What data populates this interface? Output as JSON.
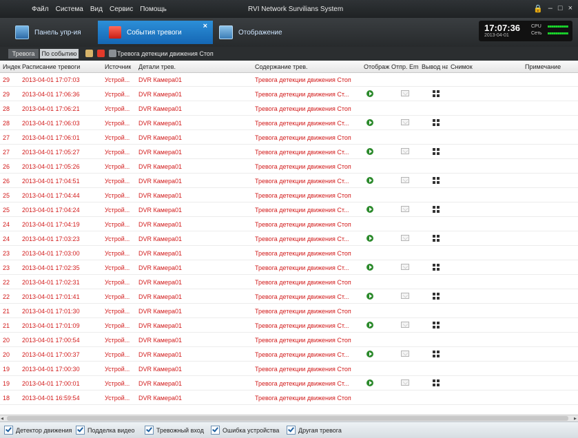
{
  "window": {
    "menu": [
      "Файл",
      "Система",
      "Вид",
      "Сервис",
      "Помощь"
    ],
    "title": "RVI Network Survilians System",
    "controls": [
      "🔒",
      "–",
      "□",
      "×"
    ]
  },
  "tabs": [
    {
      "label": "Панель упр-ия",
      "icon": "monitor-icon"
    },
    {
      "label": "События тревоги",
      "icon": "alarm-siren-icon",
      "active": true
    },
    {
      "label": "Отображение",
      "icon": "display-icon"
    }
  ],
  "status": {
    "time": "17:07:36",
    "date": "2013-04-01",
    "cpu_label": "CPU",
    "net_label": "Сеть"
  },
  "subbar": {
    "alarm_btn": "Тревога",
    "event_btn": "По событию",
    "message": "Тревога детекции движения Стоп"
  },
  "table": {
    "headers": [
      "Индек",
      "Расписание тревоги",
      "Источник",
      "Детали трев.",
      "Содержание трев.",
      "Отображ",
      "Отпр. Em",
      "Вывод на",
      "Снимок",
      "Примечание"
    ],
    "rows": [
      {
        "idx": "29",
        "time": "2013-04-01 17:07:03",
        "src": "Устрой...",
        "detail": "DVR Камера01",
        "content": "Тревога детекции движения Стоп",
        "icons": false
      },
      {
        "idx": "29",
        "time": "2013-04-01 17:06:36",
        "src": "Устрой...",
        "detail": "DVR Камера01",
        "content": "Тревога детекции движения Ст...",
        "icons": true
      },
      {
        "idx": "28",
        "time": "2013-04-01 17:06:21",
        "src": "Устрой...",
        "detail": "DVR Камера01",
        "content": "Тревога детекции движения Стоп",
        "icons": false
      },
      {
        "idx": "28",
        "time": "2013-04-01 17:06:03",
        "src": "Устрой...",
        "detail": "DVR Камера01",
        "content": "Тревога детекции движения Ст...",
        "icons": true
      },
      {
        "idx": "27",
        "time": "2013-04-01 17:06:01",
        "src": "Устрой...",
        "detail": "DVR Камера01",
        "content": "Тревога детекции движения Стоп",
        "icons": false
      },
      {
        "idx": "27",
        "time": "2013-04-01 17:05:27",
        "src": "Устрой...",
        "detail": "DVR Камера01",
        "content": "Тревога детекции движения Ст...",
        "icons": true
      },
      {
        "idx": "26",
        "time": "2013-04-01 17:05:26",
        "src": "Устрой...",
        "detail": "DVR Камера01",
        "content": "Тревога детекции движения Стоп",
        "icons": false
      },
      {
        "idx": "26",
        "time": "2013-04-01 17:04:51",
        "src": "Устрой...",
        "detail": "DVR Камера01",
        "content": "Тревога детекции движения Ст...",
        "icons": true
      },
      {
        "idx": "25",
        "time": "2013-04-01 17:04:44",
        "src": "Устрой...",
        "detail": "DVR Камера01",
        "content": "Тревога детекции движения Стоп",
        "icons": false
      },
      {
        "idx": "25",
        "time": "2013-04-01 17:04:24",
        "src": "Устрой...",
        "detail": "DVR Камера01",
        "content": "Тревога детекции движения Ст...",
        "icons": true
      },
      {
        "idx": "24",
        "time": "2013-04-01 17:04:19",
        "src": "Устрой...",
        "detail": "DVR Камера01",
        "content": "Тревога детекции движения Стоп",
        "icons": false
      },
      {
        "idx": "24",
        "time": "2013-04-01 17:03:23",
        "src": "Устрой...",
        "detail": "DVR Камера01",
        "content": "Тревога детекции движения Ст...",
        "icons": true
      },
      {
        "idx": "23",
        "time": "2013-04-01 17:03:00",
        "src": "Устрой...",
        "detail": "DVR Камера01",
        "content": "Тревога детекции движения Стоп",
        "icons": false
      },
      {
        "idx": "23",
        "time": "2013-04-01 17:02:35",
        "src": "Устрой...",
        "detail": "DVR Камера01",
        "content": "Тревога детекции движения Ст...",
        "icons": true
      },
      {
        "idx": "22",
        "time": "2013-04-01 17:02:31",
        "src": "Устрой...",
        "detail": "DVR Камера01",
        "content": "Тревога детекции движения Стоп",
        "icons": false
      },
      {
        "idx": "22",
        "time": "2013-04-01 17:01:41",
        "src": "Устрой...",
        "detail": "DVR Камера01",
        "content": "Тревога детекции движения Ст...",
        "icons": true
      },
      {
        "idx": "21",
        "time": "2013-04-01 17:01:30",
        "src": "Устрой...",
        "detail": "DVR Камера01",
        "content": "Тревога детекции движения Стоп",
        "icons": false
      },
      {
        "idx": "21",
        "time": "2013-04-01 17:01:09",
        "src": "Устрой...",
        "detail": "DVR Камера01",
        "content": "Тревога детекции движения Ст...",
        "icons": true
      },
      {
        "idx": "20",
        "time": "2013-04-01 17:00:54",
        "src": "Устрой...",
        "detail": "DVR Камера01",
        "content": "Тревога детекции движения Стоп",
        "icons": false
      },
      {
        "idx": "20",
        "time": "2013-04-01 17:00:37",
        "src": "Устрой...",
        "detail": "DVR Камера01",
        "content": "Тревога детекции движения Ст...",
        "icons": true
      },
      {
        "idx": "19",
        "time": "2013-04-01 17:00:30",
        "src": "Устрой...",
        "detail": "DVR Камера01",
        "content": "Тревога детекции движения Стоп",
        "icons": false
      },
      {
        "idx": "19",
        "time": "2013-04-01 17:00:01",
        "src": "Устрой...",
        "detail": "DVR Камера01",
        "content": "Тревога детекции движения Ст...",
        "icons": true
      },
      {
        "idx": "18",
        "time": "2013-04-01 16:59:54",
        "src": "Устрой...",
        "detail": "DVR Камера01",
        "content": "Тревога детекции движения Стоп",
        "icons": false
      }
    ]
  },
  "footer": {
    "checkboxes": [
      "Детектор движения",
      "Подделка видео",
      "Тревожный вход",
      "Ошибка устройства",
      "Другая тревога"
    ]
  },
  "colors": {
    "alarm_text": "#d21a1a",
    "active_tab": "#1e7bc8",
    "titlebar": "#2b2e30"
  }
}
